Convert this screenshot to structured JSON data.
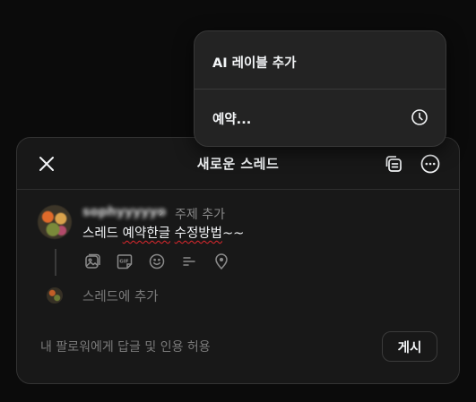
{
  "menu": {
    "items": [
      {
        "label": "AI 레이블 추가"
      },
      {
        "label": "예약...",
        "icon": "clock-icon"
      }
    ]
  },
  "composer": {
    "title": "새로운 스레드",
    "close_icon": "close-icon",
    "header_icons": [
      "drafts-icon",
      "more-icon"
    ],
    "username": "sophyyyyyo",
    "topic_placeholder": "주제 추가",
    "post_text_prefix": "스레드 ",
    "post_text_underlined": "예약한글",
    "post_text_middle": " ",
    "post_text_underlined2": "수정방법",
    "post_text_suffix": "~~",
    "tool_icons": [
      "image-icon",
      "gif-icon",
      "emoji-icon",
      "list-icon",
      "location-icon"
    ],
    "add_thread": "스레드에 추가",
    "reply_setting": "내 팔로워에게 답글 및 인용 허용",
    "post_button": "게시"
  },
  "colors": {
    "background": "#0b0b0b",
    "panel": "#181818",
    "menu": "#232323",
    "spellcheck": "#e0282e"
  }
}
